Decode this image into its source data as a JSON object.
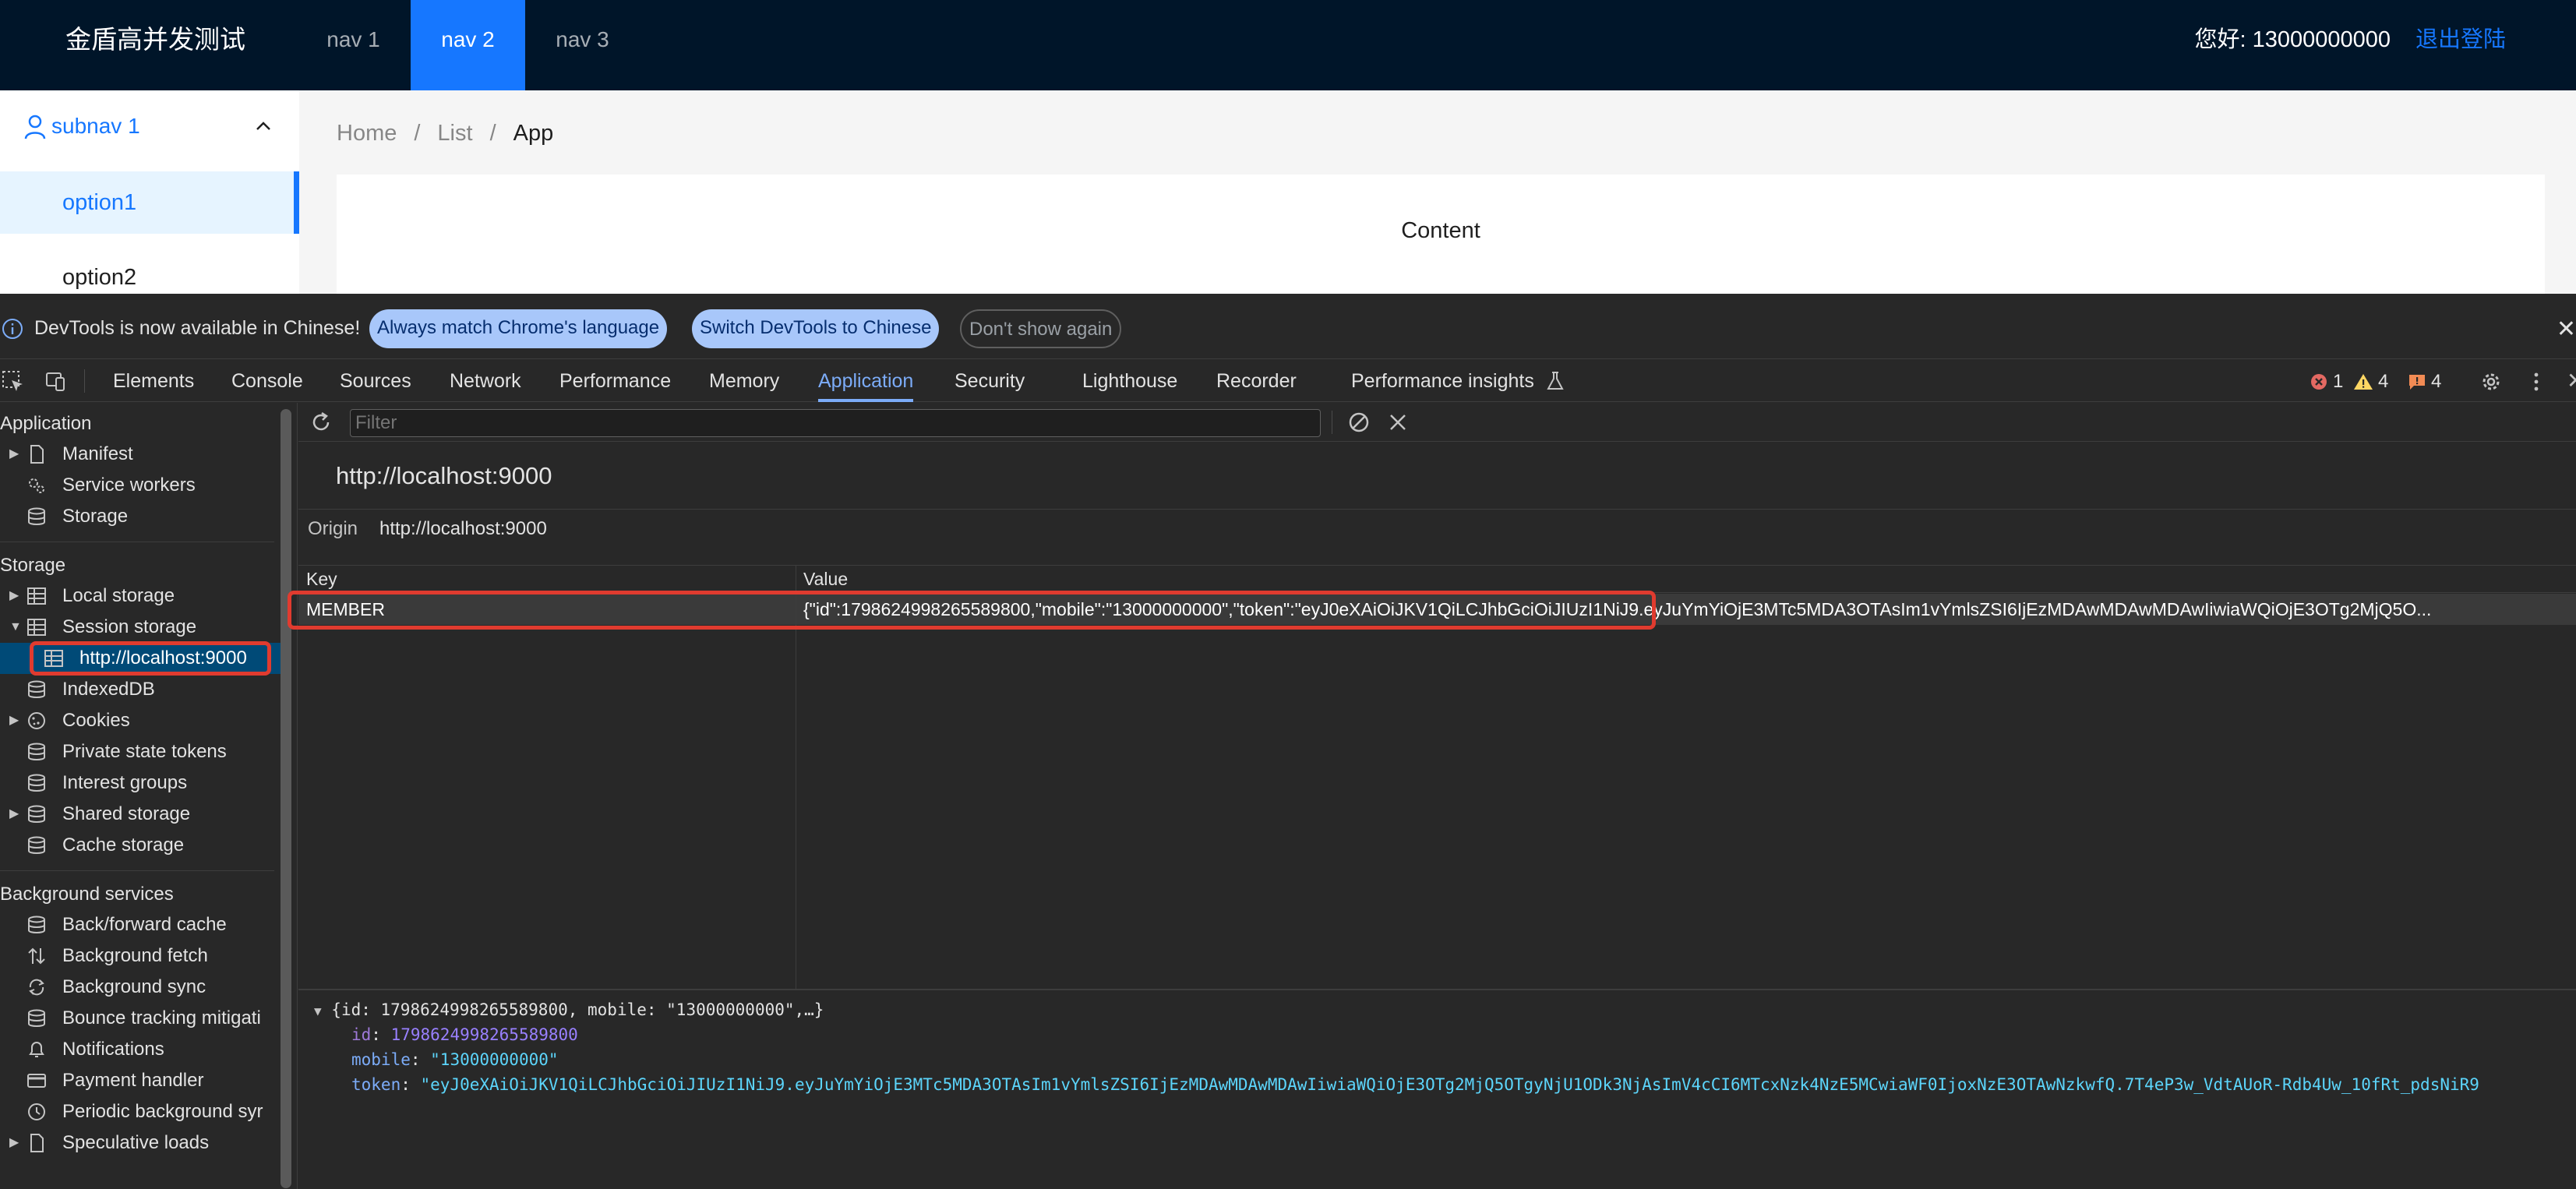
{
  "app": {
    "logo": "金盾高并发测试",
    "nav": [
      "nav 1",
      "nav 2",
      "nav 3"
    ],
    "active_nav": "nav 2",
    "greeting": "您好: 13000000000",
    "logout": "退出登陆",
    "sider": {
      "subnav_label": "subnav 1",
      "options": [
        "option1",
        "option2"
      ]
    },
    "breadcrumb": [
      "Home",
      "/",
      "List",
      "/",
      "App"
    ],
    "content": "Content",
    "accent_color": "#1677ff",
    "header_bg": "#001529"
  },
  "devtools": {
    "banner": {
      "text": "DevTools is now available in Chinese!",
      "btn_match": "Always match Chrome's language",
      "btn_switch": "Switch DevTools to Chinese",
      "btn_dismiss": "Don't show again"
    },
    "tabs": [
      "Elements",
      "Console",
      "Sources",
      "Network",
      "Performance",
      "Memory",
      "Application",
      "Security",
      "Lighthouse",
      "Recorder",
      "Performance insights"
    ],
    "active_tab": "Application",
    "counters": {
      "errors": "1",
      "warnings": "4",
      "issues": "4"
    },
    "sidebar": {
      "application_title": "Application",
      "application_items": [
        "Manifest",
        "Service workers",
        "Storage"
      ],
      "storage_title": "Storage",
      "storage_items": [
        "Local storage",
        "Session storage",
        "http://localhost:9000",
        "IndexedDB",
        "Cookies",
        "Private state tokens",
        "Interest groups",
        "Shared storage",
        "Cache storage"
      ],
      "background_title": "Background services",
      "background_items": [
        "Back/forward cache",
        "Background fetch",
        "Background sync",
        "Bounce tracking mitigati",
        "Notifications",
        "Payment handler",
        "Periodic background syr",
        "Speculative loads"
      ]
    },
    "filter_placeholder": "Filter",
    "origin_title": "http://localhost:9000",
    "origin_label": "Origin",
    "origin_value": "http://localhost:9000",
    "table": {
      "columns": [
        "Key",
        "Value"
      ],
      "rows": [
        {
          "key": "MEMBER",
          "value": "{\"id\":1798624998265589800,\"mobile\":\"13000000000\",\"token\":\"eyJ0eXAiOiJKV1QiLCJhbGciOiJIUzI1NiJ9.eyJuYmYiOjE3MTc5MDA3OTAsIm1vYmlsZSI6IjEzMDAwMDAwMDAwIiwiaWQiOjE3OTg2MjQ5O..."
        }
      ]
    },
    "preview": {
      "summary": "{id: 1798624998265589800, mobile: \"13000000000\",…}",
      "id_key": "id",
      "id_value": "1798624998265589800",
      "mobile_key": "mobile",
      "mobile_value": "\"13000000000\"",
      "token_key": "token",
      "token_value": "\"eyJ0eXAiOiJKV1QiLCJhbGciOiJIUzI1NiJ9.eyJuYmYiOjE3MTc5MDA3OTAsIm1vYmlsZSI6IjEzMDAwMDAwMDAwIiwiaWQiOjE3OTg2MjQ5OTgyNjU1ODk3NjAsImV4cCI6MTcxNzk4NzE5MCwiaWF0IjoxNzE3OTAwNzkwfQ.7T4eP3w_VdtAUoR-Rdb4Uw_10fRt_pdsNiR9"
    },
    "highlight_color": "#e03b2f"
  }
}
